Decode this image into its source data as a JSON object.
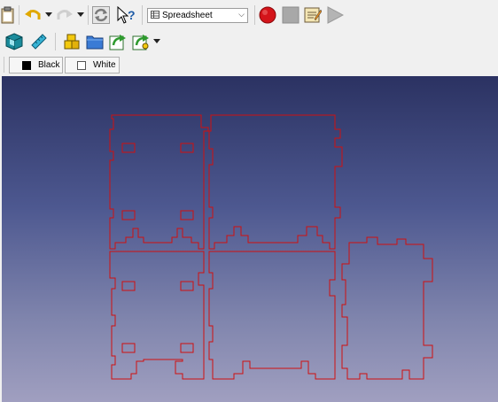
{
  "toolbar": {
    "workbench_selector": {
      "value": "Spreadsheet"
    }
  },
  "color_buttons": {
    "black": {
      "label": "Black",
      "color": "#000000"
    },
    "white": {
      "label": "White",
      "color": "#ffffff"
    }
  },
  "viewport": {
    "background_top": "#2b3262",
    "background_bottom": "#a09fc0",
    "outline_color": "#d01010"
  }
}
